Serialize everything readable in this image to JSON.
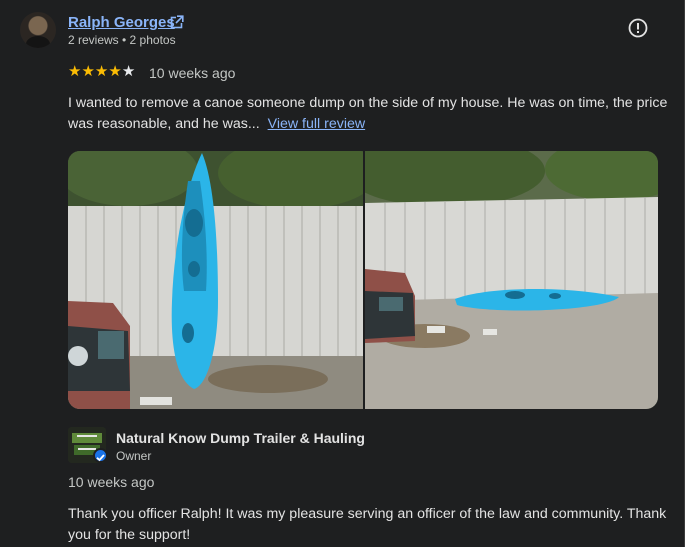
{
  "reviewer": {
    "name": "Ralph Georges",
    "meta": "2 reviews • 2 photos"
  },
  "review": {
    "rating": 4,
    "max_rating": 5,
    "date": "10 weeks ago",
    "text": "I wanted to remove a canoe someone dump on the side of my house. He was on time, the price was reasonable, and he was...",
    "view_full_label": "View full review"
  },
  "photos": [
    {
      "subject": "kayak-standing-against-fence"
    },
    {
      "subject": "kayak-lying-on-ground"
    }
  ],
  "owner_reply": {
    "business_name": "Natural Know Dump Trailer & Hauling",
    "role": "Owner",
    "date": "10 weeks ago",
    "text": "Thank you officer Ralph! It was my pleasure serving an officer of the law and community. Thank you for the support!"
  },
  "colors": {
    "background": "#1e1f20",
    "link": "#8ab4f8",
    "star": "#fbbc04",
    "kayak": "#2bb5e8"
  },
  "icons": {
    "external_link": "open-in-new-icon",
    "report": "report-icon"
  }
}
